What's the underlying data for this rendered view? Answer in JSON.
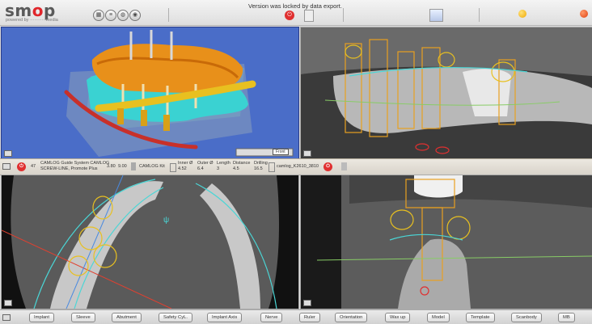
{
  "app": {
    "logo_text_pre": "sm",
    "logo_text_o": "o",
    "logo_text_post": "p",
    "powered_by": "powered by ·········· media"
  },
  "status_message": "Version was locked by data export.",
  "implant_bar": {
    "count": "47",
    "product_line1": "CAMLOG Guide System CAMLOG",
    "product_line2": "SCREW-LINE, Promote Plus",
    "diameter": "3.80",
    "length": "9.00",
    "kit": "CAMLOG Kit",
    "inner_label": "Inner Ø",
    "inner_value": "4.52",
    "outer_label": "Outer Ø",
    "outer_value": "6.4",
    "len_label": "Length",
    "len_value": "3",
    "distance_label": "Distance",
    "distance_value": "4.5",
    "drilling_label": "Drilling",
    "drilling_value": "16.5",
    "sleeve_code": "camlog_K2610_3810"
  },
  "view_controls": {
    "view_select": "Front"
  },
  "bottom_buttons": [
    "Implant",
    "Sleeve",
    "Abutment",
    "Safety CyL.",
    "Implant Axis",
    "Nerve",
    "Ruler",
    "Orientation",
    "Wax up",
    "Model",
    "Template",
    "Scanbody",
    "MB"
  ],
  "colors": {
    "viewport_3d": "#4a6dc8",
    "implant_orange": "#e89a1a",
    "nerve_cyan": "#4ad6d6",
    "bar_yellow": "#e8c020",
    "nerve_red": "#c8302a",
    "lock_red": "#e03030"
  }
}
